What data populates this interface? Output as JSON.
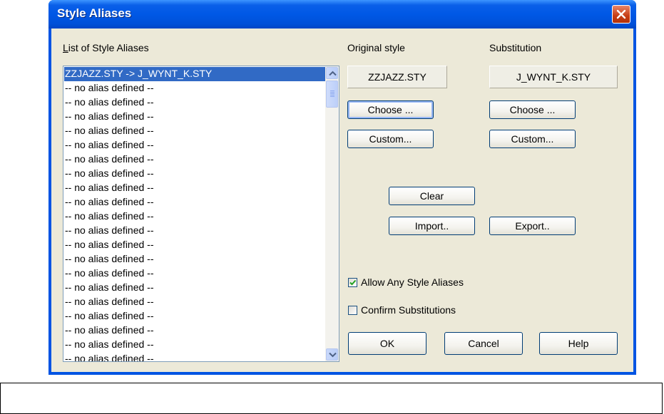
{
  "window": {
    "title": "Style Aliases"
  },
  "list": {
    "label": "List of Style Aliases",
    "items": [
      "ZZJAZZ.STY -> J_WYNT_K.STY",
      "-- no alias defined  --",
      "-- no alias defined  --",
      "-- no alias defined  --",
      "-- no alias defined  --",
      "-- no alias defined  --",
      "-- no alias defined  --",
      "-- no alias defined  --",
      "-- no alias defined  --",
      "-- no alias defined  --",
      "-- no alias defined  --",
      "-- no alias defined  --",
      "-- no alias defined  --",
      "-- no alias defined  --",
      "-- no alias defined  --",
      "-- no alias defined  --",
      "-- no alias defined  --",
      "-- no alias defined  --",
      "-- no alias defined  --",
      "-- no alias defined  --",
      "-- no alias defined  --"
    ],
    "selected_index": 0
  },
  "original": {
    "label": "Original style",
    "value": "ZZJAZZ.STY",
    "choose_label": "Choose ...",
    "custom_label": "Custom..."
  },
  "substitution": {
    "label": "Substitution",
    "value": "J_WYNT_K.STY",
    "choose_label": "Choose ...",
    "custom_label": "Custom..."
  },
  "actions": {
    "clear_label": "Clear",
    "import_label": "Import..",
    "export_label": "Export.."
  },
  "options": {
    "allow_any": {
      "label": "Allow Any Style Aliases",
      "checked": true
    },
    "confirm": {
      "label": "Confirm Substitutions",
      "checked": false
    }
  },
  "footer": {
    "ok_label": "OK",
    "cancel_label": "Cancel",
    "help_label": "Help"
  },
  "colors": {
    "titlebar": "#0054e3",
    "selection": "#316ac5",
    "dialog_bg": "#ece9d8",
    "close_button": "#c63c14",
    "checkmark": "#21a121"
  },
  "icons": {
    "close": "close-x-icon",
    "scroll_up": "chevron-up-icon",
    "scroll_down": "chevron-down-icon",
    "check": "checkmark-icon"
  }
}
